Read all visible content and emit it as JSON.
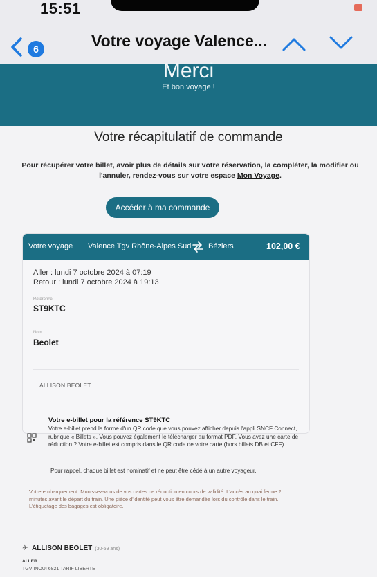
{
  "status_bar": {
    "time": "15:51"
  },
  "nav": {
    "back_icon": "chevron-left-icon",
    "unread_count": "6",
    "title": "Votre voyage Valence...",
    "prev_icon": "chevron-up-icon",
    "next_icon": "chevron-down-icon",
    "accent_color": "#1f7ae0"
  },
  "hero": {
    "heading": "Merci",
    "subheading": "Et bon voyage !",
    "background": "#1b6e84"
  },
  "recap": {
    "title": "Votre récapitulatif de commande",
    "intro": "Pour récupérer votre billet, avoir plus de détails sur votre réservation, la compléter, la modifier ou l'annuler, rendez-vous sur votre espace",
    "intro_link": "Mon Voyage",
    "button_label": "Accéder à ma commande"
  },
  "trip": {
    "label": "Votre voyage",
    "from": "Valence Tgv Rhône-Alpes Sud",
    "swap_icon": "swap-arrows-icon",
    "to": "Béziers",
    "price": "102,00 €",
    "outbound": "Aller : lundi 7 octobre 2024 à 07:19",
    "return": "Retour : lundi 7 octobre 2024 à 19:13",
    "reference_caption": "Référence",
    "reference": "ST9KTC",
    "name_caption": "Nom",
    "last_name": "Beolet",
    "passenger": "ALLISON BEOLET"
  },
  "ebillet": {
    "title": "Votre e-billet pour la référence ST9KTC",
    "icon": "qr-code-icon",
    "text": "Votre e-billet prend la forme d'un QR code que vous pouvez afficher depuis l'appli SNCF Connect, rubrique « Billets ». Vous pouvez également le télécharger au format PDF. Vous avez une carte de réduction ? Votre e-billet est compris dans le QR code de votre carte (hors billets DB et CFF).",
    "note": "Pour rappel, chaque billet est nominatif et ne peut être cédé à un autre voyageur."
  },
  "boarding": {
    "text": "Votre embarquement. Munissez-vous de vos cartes de réduction en cours de validité. L'accès au quai ferme 2 minutes avant le départ du train. Une pièce d'identité peut vous être demandée lors du contrôle dans le train. L'étiquetage des bagages est obligatoire."
  },
  "traveller": {
    "icon": "person-icon",
    "name": "ALLISON BEOLET",
    "age": "(30-59 ans)",
    "direction": "ALLER",
    "train": "TGV INOUI 6821  TARIF LIBERTE"
  }
}
